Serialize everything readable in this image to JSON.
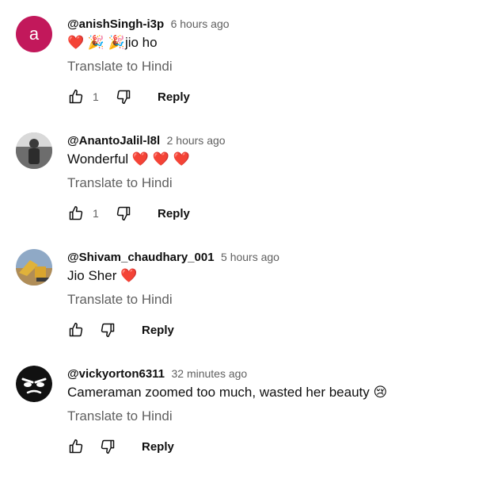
{
  "comments": [
    {
      "author": "@anishSingh-i3p",
      "time": "6 hours ago",
      "text": "❤️ 🎉 🎉jio ho",
      "translate": "Translate to Hindi",
      "likes": "1",
      "reply": "Reply",
      "avatar_letter": "a",
      "avatar_color": "#c2185b"
    },
    {
      "author": "@AnantoJalil-l8l",
      "time": "2 hours ago",
      "text": "Wonderful ❤️ ❤️ ❤️",
      "translate": "Translate to Hindi",
      "likes": "1",
      "reply": "Reply"
    },
    {
      "author": "@Shivam_chaudhary_001",
      "time": "5 hours ago",
      "text": "Jio Sher ❤️",
      "translate": "Translate to Hindi",
      "likes": "",
      "reply": "Reply"
    },
    {
      "author": "@vickyorton6311",
      "time": "32 minutes ago",
      "text": "Cameraman zoomed too much, wasted her beauty 😢",
      "translate": "Translate to Hindi",
      "likes": "",
      "reply": "Reply"
    }
  ],
  "icons": {
    "like": "thumbs-up-icon",
    "dislike": "thumbs-down-icon"
  }
}
